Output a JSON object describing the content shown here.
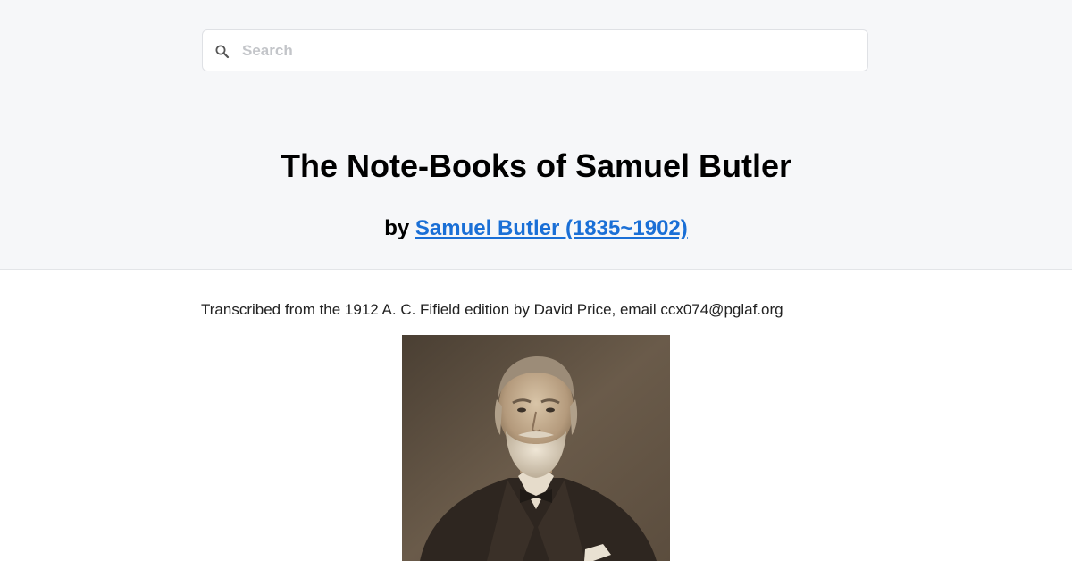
{
  "search": {
    "placeholder": "Search",
    "value": ""
  },
  "book": {
    "title": "The Note-Books of Samuel Butler",
    "by_prefix": "by ",
    "author_link": "Samuel Butler (1835~1902)"
  },
  "content": {
    "transcription_note": "Transcribed from the 1912 A. C. Fifield edition by David Price, email ccx074@pglaf.org"
  },
  "colors": {
    "header_bg": "#f6f7f9",
    "link": "#1a6fd6",
    "portrait_sepia": "#5a4d3f"
  },
  "icons": {
    "search": "search-icon"
  }
}
